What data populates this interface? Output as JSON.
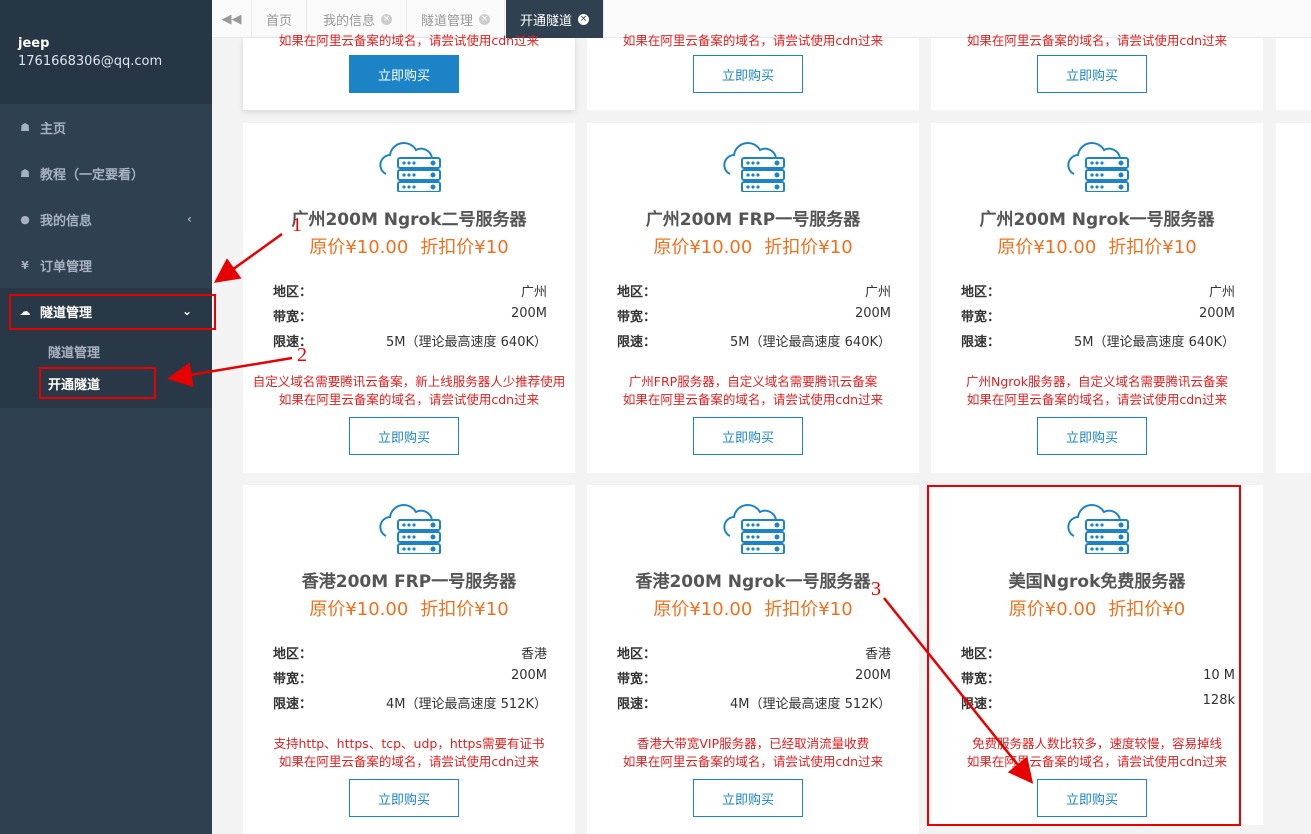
{
  "user": {
    "name": "jeep",
    "email": "1761668306@qq.com"
  },
  "sidebar": {
    "items": [
      {
        "label": "主页",
        "icon": "home-icon"
      },
      {
        "label": "教程（一定要看）",
        "icon": "home-icon"
      },
      {
        "label": "我的信息",
        "icon": "user-icon"
      },
      {
        "label": "订单管理",
        "icon": "yen-icon"
      },
      {
        "label": "隧道管理",
        "icon": "cloud-icon"
      }
    ],
    "subitems": [
      "隧道管理",
      "开通隧道"
    ]
  },
  "tabs": [
    "首页",
    "我的信息",
    "隧道管理",
    "开通隧道"
  ],
  "common": {
    "buy_label": "立即购买",
    "region_key": "地区：",
    "bandwidth_key": "带宽：",
    "speed_key": "限速：",
    "cdn_note": "如果在阿里云备案的域名，请尝试使用cdn过来"
  },
  "cards": [
    {
      "title": "广州200M Ngrok二号服务器",
      "orig": "原价¥10.00",
      "disc": "折扣价¥10",
      "region": "广州",
      "bandwidth": "200M",
      "speed": "5M（理论最高速度 640K）",
      "note": "自定义域名需要腾讯云备案，新上线服务器人少推荐使用"
    },
    {
      "title": "广州200M FRP一号服务器",
      "orig": "原价¥10.00",
      "disc": "折扣价¥10",
      "region": "广州",
      "bandwidth": "200M",
      "speed": "5M（理论最高速度 640K）",
      "note": "广州FRP服务器，自定义域名需要腾讯云备案"
    },
    {
      "title": "广州200M Ngrok一号服务器",
      "orig": "原价¥10.00",
      "disc": "折扣价¥10",
      "region": "广州",
      "bandwidth": "200M",
      "speed": "5M（理论最高速度 640K）",
      "note": "广州Ngrok服务器，自定义域名需要腾讯云备案"
    },
    {
      "title": "香港200M FRP一号服务器",
      "orig": "原价¥10.00",
      "disc": "折扣价¥10",
      "region": "香港",
      "bandwidth": "200M",
      "speed": "4M（理论最高速度 512K）",
      "note": "支持http、https、tcp、udp，https需要有证书"
    },
    {
      "title": "香港200M Ngrok一号服务器",
      "orig": "原价¥10.00",
      "disc": "折扣价¥10",
      "region": "香港",
      "bandwidth": "200M",
      "speed": "4M（理论最高速度 512K）",
      "note": "香港大带宽VIP服务器，已经取消流量收费"
    },
    {
      "title": "美国Ngrok免费服务器",
      "orig": "原价¥0.00",
      "disc": "折扣价¥0",
      "region": "",
      "bandwidth": "10 M",
      "speed": "128k",
      "note": "免费服务器人数比较多，速度较慢，容易掉线"
    }
  ],
  "annotations": [
    "1",
    "2",
    "3"
  ],
  "colors": {
    "sidebar": "#2f4050",
    "accent": "#1c84c6",
    "price": "#f0701e",
    "note": "#e02020",
    "annotation": "#e60000"
  }
}
